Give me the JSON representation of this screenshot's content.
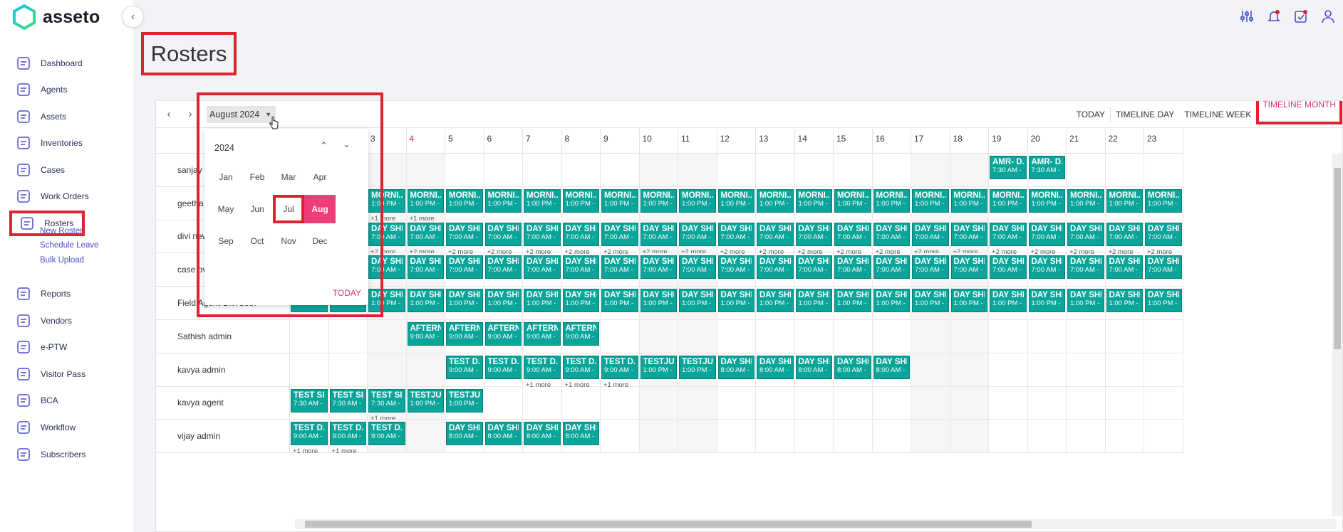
{
  "brand": {
    "name": "asseto"
  },
  "sidebar": {
    "items": [
      {
        "label": "Dashboard",
        "icon": "dashboard-icon"
      },
      {
        "label": "Agents",
        "icon": "agents-icon"
      },
      {
        "label": "Assets",
        "icon": "assets-icon"
      },
      {
        "label": "Inventories",
        "icon": "inventories-icon"
      },
      {
        "label": "Cases",
        "icon": "cases-icon"
      },
      {
        "label": "Work Orders",
        "icon": "work-orders-icon"
      },
      {
        "label": "Rosters",
        "icon": "rosters-icon",
        "active": true
      },
      {
        "label": "Reports",
        "icon": "reports-icon"
      },
      {
        "label": "Vendors",
        "icon": "vendors-icon"
      },
      {
        "label": "e-PTW",
        "icon": "eptw-icon"
      },
      {
        "label": "Visitor Pass",
        "icon": "visitor-pass-icon"
      },
      {
        "label": "BCA",
        "icon": "bca-icon"
      },
      {
        "label": "Workflow",
        "icon": "workflow-icon"
      },
      {
        "label": "Subscribers",
        "icon": "subscribers-icon"
      }
    ],
    "sub_items": [
      "New Roster",
      "Schedule Leave",
      "Bulk Upload"
    ]
  },
  "page": {
    "title": "Rosters"
  },
  "toolbar": {
    "date_label": "August 2024",
    "views": [
      "TODAY",
      "TIMELINE DAY",
      "TIMELINE WEEK",
      "TIMELINE MONTH"
    ],
    "active_view": "TIMELINE MONTH"
  },
  "picker": {
    "year": "2024",
    "months": [
      "Jan",
      "Feb",
      "Mar",
      "Apr",
      "May",
      "Jun",
      "Jul",
      "Aug",
      "Sep",
      "Oct",
      "Nov",
      "Dec"
    ],
    "selected": "Aug",
    "highlighted": "Jul",
    "today_label": "TODAY"
  },
  "calendar": {
    "days": [
      "1",
      "2",
      "3",
      "4",
      "5",
      "6",
      "7",
      "8",
      "9",
      "10",
      "11",
      "12",
      "13",
      "14",
      "15",
      "16",
      "17",
      "18",
      "19",
      "20",
      "21",
      "22",
      "23"
    ],
    "red_day": "4",
    "weekend_days": [
      "3",
      "4",
      "10",
      "11",
      "17",
      "18"
    ],
    "rows": [
      {
        "name": "sanjay",
        "events": {
          "19": [
            "AMR- D...",
            "7:30 AM -",
            ""
          ],
          "20": [
            "AMR- D...",
            "7:30 AM -",
            ""
          ]
        }
      },
      {
        "name": "geetha",
        "range": [
          1,
          23
        ],
        "event": [
          "MORNI...",
          "1:00 PM -"
        ],
        "more": {
          "3": "+1 more",
          "4": "+1 more"
        }
      },
      {
        "name": "divi new",
        "range": [
          1,
          23
        ],
        "event": [
          "DAY SHI...",
          "7:00 AM -"
        ],
        "more_all": "+2 more"
      },
      {
        "name": "case pv",
        "range": [
          1,
          23
        ],
        "event": [
          "DAY SHI...",
          "7:00 AM -"
        ]
      },
      {
        "name": "Field Agent-Divi both",
        "range": [
          1,
          23
        ],
        "event": [
          "DAY SHI...",
          "1:00 PM -"
        ]
      },
      {
        "name": "Sathish admin",
        "list": {
          "4": [
            "AFTERN...",
            "9:00 AM -"
          ],
          "5": [
            "AFTERN...",
            "9:00 AM -"
          ],
          "6": [
            "AFTERN...",
            "9:00 AM -"
          ],
          "7": [
            "AFTERN...",
            "9:00 AM -"
          ],
          "8": [
            "AFTERN...",
            "9:00 AM -"
          ]
        }
      },
      {
        "name": "kavya admin",
        "list": {
          "5": [
            "TEST D...",
            "9:00 AM -"
          ],
          "6": [
            "TEST D...",
            "9:00 AM -"
          ],
          "7": [
            "TEST D...",
            "9:00 AM -"
          ],
          "8": [
            "TEST D...",
            "9:00 AM -"
          ],
          "9": [
            "TEST D...",
            "9:00 AM -"
          ],
          "10": [
            "TESTJU...",
            "1:00 PM -"
          ],
          "11": [
            "TESTJU...",
            "1:00 PM -"
          ],
          "12": [
            "DAY SHI...",
            "8:00 AM -"
          ],
          "13": [
            "DAY SHI...",
            "8:00 AM -"
          ],
          "14": [
            "DAY SHI...",
            "8:00 AM -"
          ],
          "15": [
            "DAY SHI...",
            "8:00 AM -"
          ],
          "16": [
            "DAY SHI...",
            "8:00 AM -"
          ]
        },
        "more": {
          "7": "+1 more",
          "8": "+1 more",
          "9": "+1 more"
        }
      },
      {
        "name": "kavya agent",
        "list": {
          "1": [
            "TEST SI...",
            "7:30 AM -"
          ],
          "2": [
            "TEST SI...",
            "7:30 AM -"
          ],
          "3": [
            "TEST SI...",
            "7:30 AM -"
          ],
          "4": [
            "TESTJU...",
            "1:00 PM -"
          ],
          "5": [
            "TESTJU...",
            "1:00 PM -"
          ]
        },
        "more": {
          "3": "+1 more"
        }
      },
      {
        "name": "vijay admin",
        "list": {
          "1": [
            "TEST D...",
            "9:00 AM -"
          ],
          "2": [
            "TEST D...",
            "9:00 AM -"
          ],
          "3": [
            "TEST D...",
            "9:00 AM -"
          ],
          "5": [
            "DAY SHI...",
            "8:00 AM -"
          ],
          "6": [
            "DAY SHI...",
            "8:00 AM -"
          ],
          "7": [
            "DAY SHI...",
            "8:00 AM -"
          ],
          "8": [
            "DAY SHI...",
            "8:00 AM -"
          ]
        },
        "more": {
          "1": "+1 more",
          "2": "+1 more"
        }
      }
    ]
  },
  "colors": {
    "event": "#0aa59a",
    "accent": "#ee3d78",
    "highlight_box": "#e0212e",
    "nav_text": "#2b2f5a"
  }
}
